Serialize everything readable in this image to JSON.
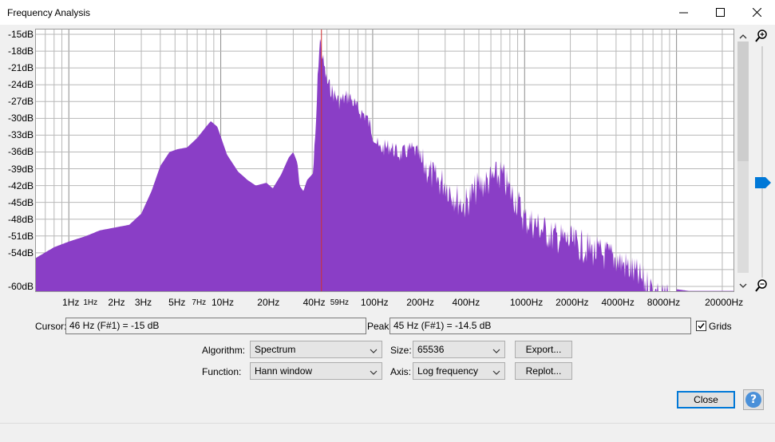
{
  "window": {
    "title": "Frequency Analysis",
    "icons": [
      "minimize-icon",
      "maximize-icon",
      "close-icon"
    ]
  },
  "chart_data": {
    "type": "area",
    "xscale": "log",
    "xlim": [
      0.6,
      24000
    ],
    "ylim": [
      -61,
      -14
    ],
    "y_ticks": [
      "-15dB",
      "-18dB",
      "-21dB",
      "-24dB",
      "-27dB",
      "-30dB",
      "-33dB",
      "-36dB",
      "-39dB",
      "-42dB",
      "-45dB",
      "-48dB",
      "-51dB",
      "-54dB",
      "-60dB"
    ],
    "x_ticks": [
      "1Hz",
      "1Hz",
      "2Hz",
      "3Hz",
      "5Hz",
      "7Hz",
      "10Hz",
      "20Hz",
      "40Hz",
      "59Hz",
      "100Hz",
      "200Hz",
      "400Hz",
      "1000Hz",
      "2000Hz",
      "4000Hz",
      "8000Hz",
      "20000Hz"
    ],
    "grid": true,
    "fill_color": "#8a3ec6",
    "cursor_line_color": "#d03030",
    "cursor_hz": 46,
    "envelope": [
      [
        0.6,
        -55
      ],
      [
        0.8,
        -53
      ],
      [
        1,
        -52
      ],
      [
        1.3,
        -51
      ],
      [
        1.6,
        -50
      ],
      [
        2,
        -49.5
      ],
      [
        2.5,
        -49
      ],
      [
        3,
        -47
      ],
      [
        3.5,
        -43
      ],
      [
        4,
        -38.5
      ],
      [
        4.6,
        -36
      ],
      [
        5.2,
        -35.5
      ],
      [
        6,
        -35.2
      ],
      [
        7,
        -33.5
      ],
      [
        8,
        -31.5
      ],
      [
        8.6,
        -30.5
      ],
      [
        9.5,
        -31.5
      ],
      [
        11,
        -36.5
      ],
      [
        13,
        -39.5
      ],
      [
        15,
        -41
      ],
      [
        17,
        -42
      ],
      [
        20,
        -41.5
      ],
      [
        22,
        -42.5
      ],
      [
        25,
        -40
      ],
      [
        28,
        -37
      ],
      [
        30,
        -36
      ],
      [
        32,
        -38
      ],
      [
        33,
        -42
      ],
      [
        35,
        -43
      ],
      [
        37,
        -41
      ],
      [
        40,
        -40
      ],
      [
        42,
        -32
      ],
      [
        44,
        -18
      ],
      [
        45,
        -14.5
      ],
      [
        47,
        -18
      ],
      [
        50,
        -22
      ],
      [
        55,
        -24
      ],
      [
        60,
        -25.5
      ],
      [
        70,
        -24.5
      ],
      [
        80,
        -27
      ],
      [
        90,
        -28
      ],
      [
        100,
        -31
      ],
      [
        110,
        -34
      ],
      [
        130,
        -33.5
      ],
      [
        150,
        -35
      ],
      [
        180,
        -34
      ],
      [
        220,
        -35.5
      ],
      [
        260,
        -38
      ],
      [
        300,
        -38.5
      ],
      [
        350,
        -41
      ],
      [
        400,
        -42.5
      ],
      [
        500,
        -39
      ],
      [
        600,
        -38
      ],
      [
        700,
        -37
      ],
      [
        800,
        -40
      ],
      [
        900,
        -42
      ],
      [
        1000,
        -45
      ],
      [
        1200,
        -46
      ],
      [
        1500,
        -48
      ],
      [
        2000,
        -49
      ],
      [
        2500,
        -50
      ],
      [
        3000,
        -51
      ],
      [
        4000,
        -52
      ],
      [
        5000,
        -54
      ],
      [
        6000,
        -56
      ],
      [
        8000,
        -59
      ],
      [
        10000,
        -60.5
      ],
      [
        12000,
        -60.8
      ],
      [
        24000,
        -60.8
      ]
    ]
  },
  "cursor": {
    "label": "Cursor:",
    "value": "46 Hz (F#1) = -15 dB"
  },
  "peak": {
    "label": "Peak:",
    "value": "45 Hz (F#1) = -14.5 dB"
  },
  "grids": {
    "label": "Grids",
    "checked": true
  },
  "controls": {
    "algorithm": {
      "label": "Algorithm:",
      "value": "Spectrum"
    },
    "function": {
      "label": "Function:",
      "value": "Hann window"
    },
    "size": {
      "label": "Size:",
      "value": "65536"
    },
    "axis": {
      "label": "Axis:",
      "value": "Log frequency"
    },
    "export_label": "Export...",
    "replot_label": "Replot...",
    "close_label": "Close",
    "help_label": "?"
  },
  "zoom": {
    "icons": [
      "zoom-in-icon",
      "zoom-out-icon"
    ],
    "level": 0.67
  }
}
